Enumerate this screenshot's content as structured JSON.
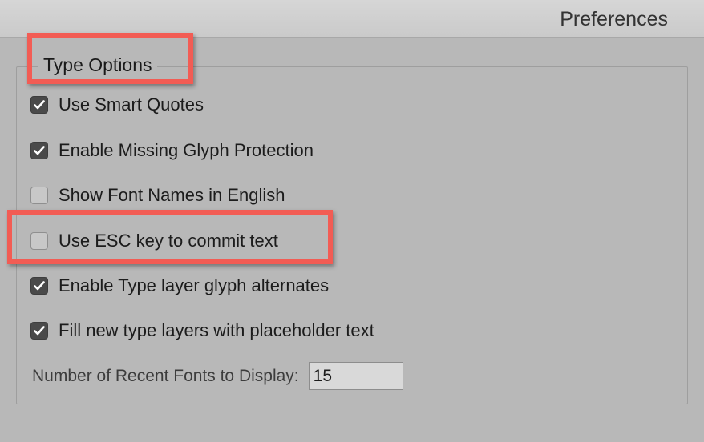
{
  "window": {
    "title": "Preferences"
  },
  "type_options": {
    "legend": "Type Options",
    "options": [
      {
        "label": "Use Smart Quotes",
        "checked": true
      },
      {
        "label": "Enable Missing Glyph Protection",
        "checked": true
      },
      {
        "label": "Show Font Names in English",
        "checked": false
      },
      {
        "label": "Use ESC key to commit text",
        "checked": false
      },
      {
        "label": "Enable Type layer glyph alternates",
        "checked": true
      },
      {
        "label": "Fill new type layers with placeholder text",
        "checked": true
      }
    ],
    "recent_fonts": {
      "label": "Number of Recent Fonts to Display:",
      "value": "15"
    }
  },
  "colors": {
    "highlight": "#f25c54",
    "checkbox_on": "#4a4a4a",
    "background": "#b8b8b8"
  },
  "icons": {
    "checkmark": "checkmark-icon"
  }
}
